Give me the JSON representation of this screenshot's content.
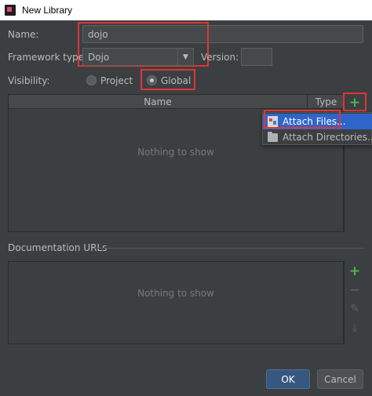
{
  "window": {
    "title": "New Library",
    "icon": "intellij-app-icon"
  },
  "form": {
    "name_label": "Name:",
    "name_value": "dojo",
    "framework_label": "Framework type:",
    "framework_value": "Dojo",
    "version_label": "Version:",
    "version_value": "",
    "visibility_label": "Visibility:",
    "visibility_options": [
      {
        "label": "Project",
        "selected": false
      },
      {
        "label": "Global",
        "selected": true
      }
    ]
  },
  "files_table": {
    "columns": [
      "Name",
      "Type"
    ],
    "empty_text": "Nothing to show",
    "tools": [
      "add-icon"
    ]
  },
  "attach_menu": {
    "items": [
      {
        "label": "Attach Files...",
        "icon": "attach-files-icon",
        "selected": true
      },
      {
        "label": "Attach Directories...",
        "icon": "folder-icon",
        "selected": false
      }
    ]
  },
  "docs": {
    "label": "Documentation URLs",
    "empty_text": "Nothing to show",
    "tools": [
      "add-icon",
      "remove-icon",
      "edit-icon",
      "download-icon"
    ]
  },
  "buttons": {
    "ok": "OK",
    "cancel": "Cancel"
  },
  "colors": {
    "background": "#3c3f41",
    "accent": "#2f65ca",
    "highlight": "#e03535",
    "add": "#4fb34f"
  }
}
